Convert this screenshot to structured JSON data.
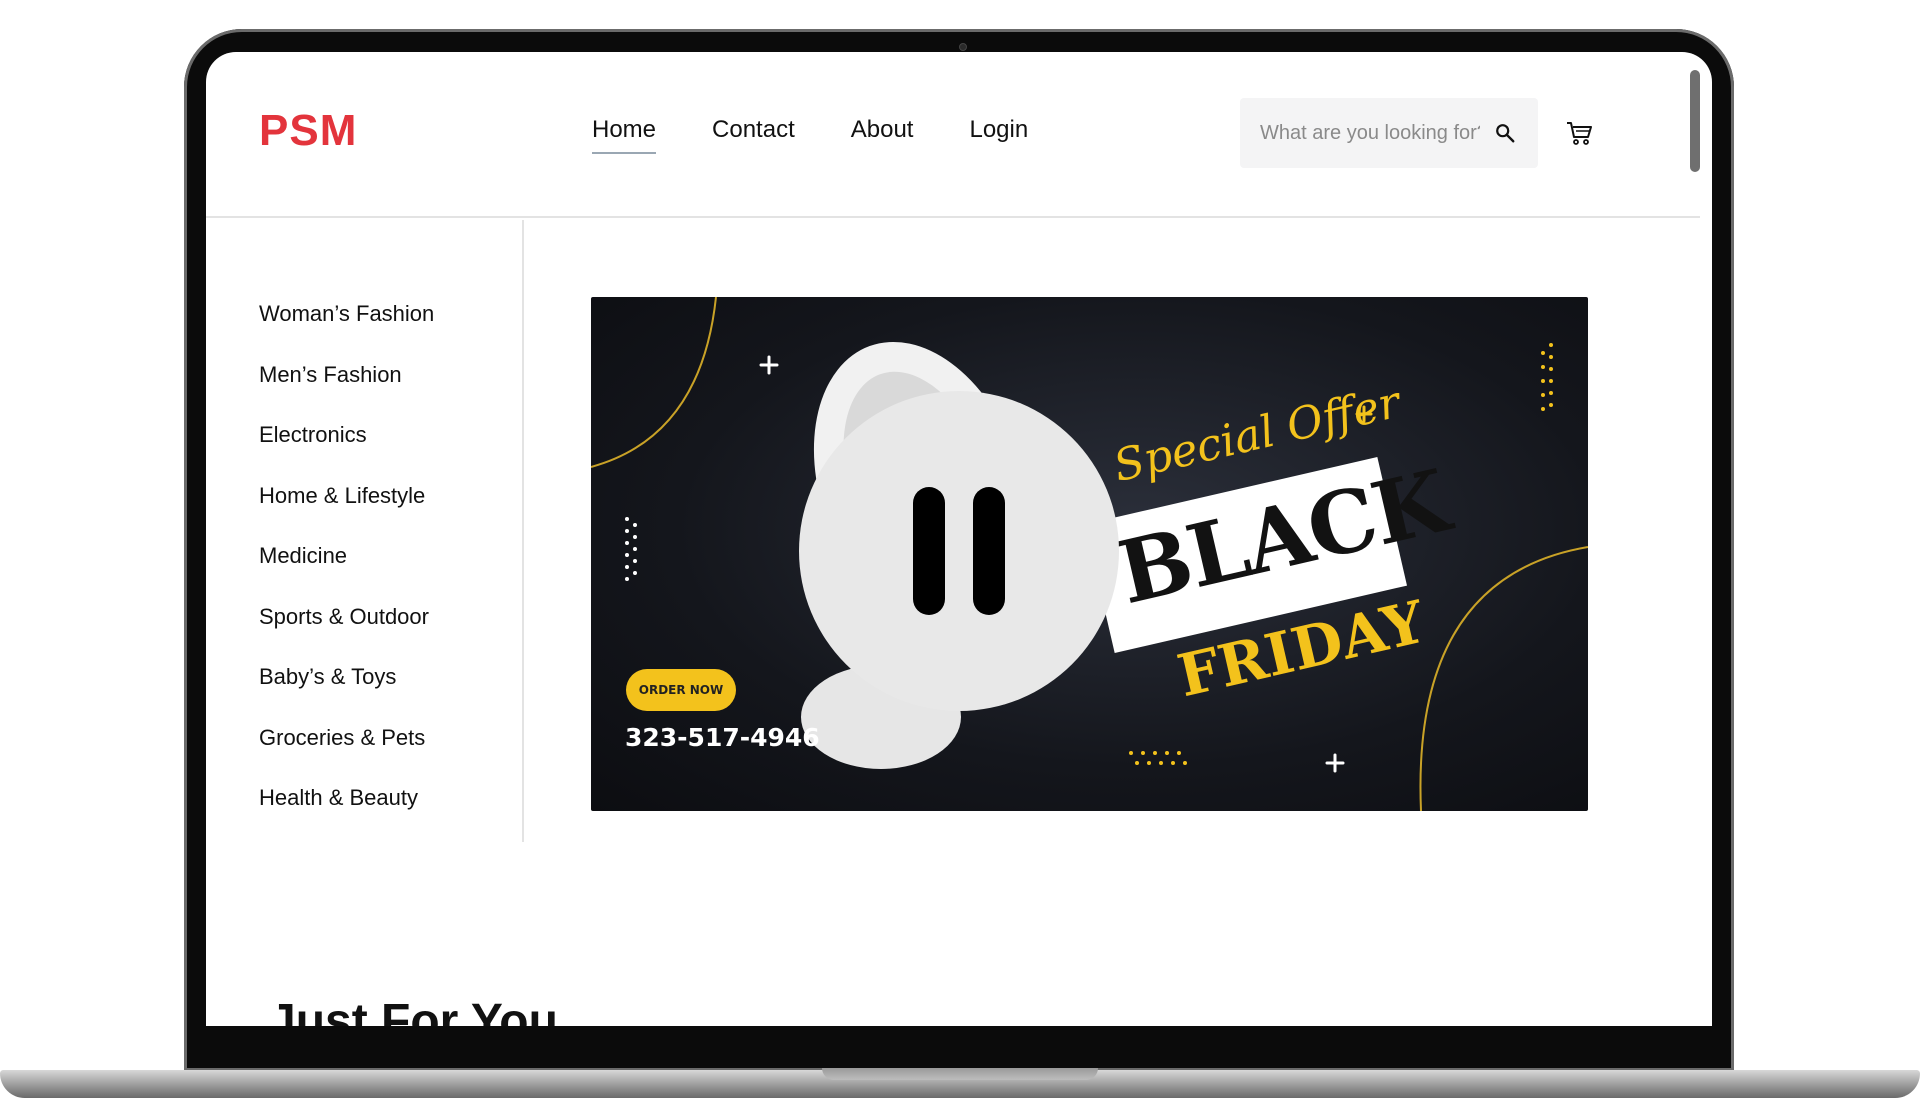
{
  "brand": {
    "logo": "PSM",
    "accent": "#e3343c"
  },
  "nav": {
    "items": [
      {
        "label": "Home",
        "active": true
      },
      {
        "label": "Contact"
      },
      {
        "label": "About"
      },
      {
        "label": "Login"
      }
    ]
  },
  "search": {
    "placeholder": "What are you looking for?",
    "icon": "search-icon"
  },
  "cart": {
    "icon": "cart-icon"
  },
  "sidebar": {
    "categories": [
      "Woman’s Fashion",
      "Men’s Fashion",
      "Electronics",
      "Home & Lifestyle",
      "Medicine",
      "Sports & Outdoor",
      "Baby’s & Toys",
      "Groceries & Pets",
      "Health & Beauty"
    ]
  },
  "banner": {
    "tagline": "Special Offer",
    "headline": "BLACK",
    "subheadline": "FRIDAY",
    "cta": "ORDER NOW",
    "phone": "323-517-4946",
    "accent": "#f3c21c",
    "overlay_control": "pause-icon"
  },
  "sections": {
    "just_for_you": "Just For You"
  }
}
